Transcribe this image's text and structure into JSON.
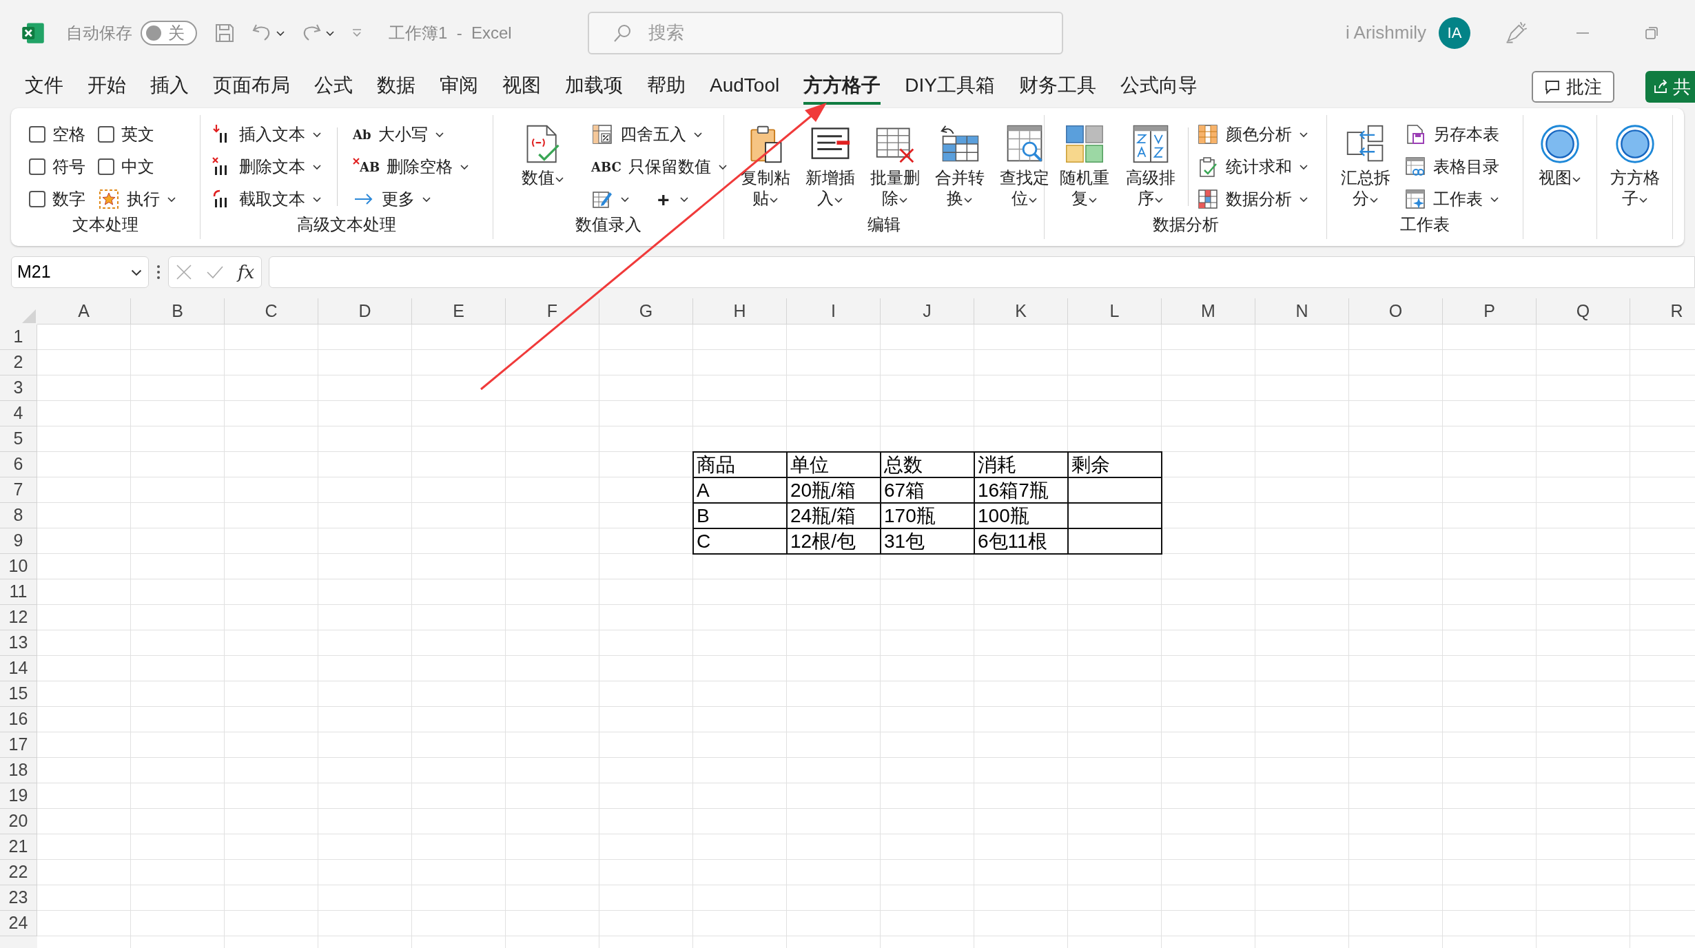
{
  "title_bar": {
    "autosave_label": "自动保存",
    "autosave": {
      "on": false,
      "label": "关"
    },
    "doc_title": "工作簿1  -  Excel",
    "search_placeholder": "搜索",
    "user_name": "i Arishmily",
    "avatar_initials": "IA"
  },
  "menu_tabs": [
    {
      "label": "文件",
      "selected": false
    },
    {
      "label": "开始",
      "selected": false
    },
    {
      "label": "插入",
      "selected": false
    },
    {
      "label": "页面布局",
      "selected": false
    },
    {
      "label": "公式",
      "selected": false
    },
    {
      "label": "数据",
      "selected": false
    },
    {
      "label": "审阅",
      "selected": false
    },
    {
      "label": "视图",
      "selected": false
    },
    {
      "label": "加载项",
      "selected": false
    },
    {
      "label": "帮助",
      "selected": false
    },
    {
      "label": "AudTool",
      "selected": false
    },
    {
      "label": "方方格子",
      "selected": true
    },
    {
      "label": "DIY工具箱",
      "selected": false
    },
    {
      "label": "财务工具",
      "selected": false
    },
    {
      "label": "公式向导",
      "selected": false
    }
  ],
  "comment_button": "批注",
  "share_button": "共",
  "ribbon": [
    {
      "title": "文本处理",
      "columns": [
        [
          {
            "kind": "checkbox",
            "label": "空格",
            "checked": false
          },
          {
            "kind": "checkbox",
            "label": "符号",
            "checked": false
          },
          {
            "kind": "checkbox",
            "label": "数字",
            "checked": false
          }
        ],
        [
          {
            "kind": "checkbox",
            "label": "英文",
            "checked": false
          },
          {
            "kind": "checkbox",
            "label": "中文",
            "checked": false
          },
          {
            "kind": "small",
            "label": "执行",
            "dropdown": true
          }
        ]
      ]
    },
    {
      "title": "高级文本处理",
      "columns": [
        [
          {
            "kind": "small",
            "label": "插入文本",
            "dropdown": true
          },
          {
            "kind": "small",
            "label": "删除文本",
            "dropdown": true
          },
          {
            "kind": "small",
            "label": "截取文本",
            "dropdown": true
          }
        ],
        [
          {
            "kind": "small",
            "label": "大小写",
            "icon_text": "Ab",
            "dropdown": true
          },
          {
            "kind": "small",
            "label": "删除空格",
            "icon_text": "AB",
            "dropdown": true
          },
          {
            "kind": "small",
            "label": "更多",
            "dropdown": true
          }
        ]
      ]
    },
    {
      "title": "数值录入",
      "columns": [
        [
          {
            "kind": "large",
            "label": "数值",
            "dropdown": true
          }
        ],
        [
          {
            "kind": "small",
            "label": "四舍五入",
            "dropdown": true
          },
          {
            "kind": "small",
            "label": "只保留数值",
            "icon_text": "ABC",
            "dropdown": true
          },
          {
            "kind": "pair",
            "second_label": "+",
            "dropdown": true
          }
        ]
      ]
    },
    {
      "title": "编辑",
      "columns": [
        [
          {
            "kind": "large",
            "label": "复制粘贴",
            "dropdown": true
          }
        ],
        [
          {
            "kind": "large",
            "label": "新增插入",
            "dropdown": true
          }
        ],
        [
          {
            "kind": "large",
            "label": "批量删除",
            "dropdown": true
          }
        ],
        [
          {
            "kind": "large",
            "label": "合并转换",
            "dropdown": true
          }
        ],
        [
          {
            "kind": "large",
            "label": "查找定位",
            "dropdown": true
          }
        ]
      ]
    },
    {
      "title": "数据分析",
      "columns": [
        [
          {
            "kind": "large",
            "label": "随机重复",
            "dropdown": true
          }
        ],
        [
          {
            "kind": "large",
            "label": "高级排序",
            "dropdown": true
          }
        ],
        [
          {
            "kind": "small",
            "label": "颜色分析",
            "dropdown": true
          },
          {
            "kind": "small",
            "label": "统计求和",
            "dropdown": true
          },
          {
            "kind": "small",
            "label": "数据分析",
            "dropdown": true
          }
        ]
      ]
    },
    {
      "title": "工作表",
      "columns": [
        [
          {
            "kind": "large",
            "label": "汇总拆分",
            "dropdown": true
          }
        ],
        [
          {
            "kind": "small",
            "label": "另存本表",
            "dropdown": false
          },
          {
            "kind": "small",
            "label": "表格目录",
            "dropdown": false
          },
          {
            "kind": "small",
            "label": "工作表",
            "dropdown": true
          }
        ]
      ]
    },
    {
      "columns": [
        [
          {
            "kind": "large",
            "label": "视图",
            "dropdown": true
          }
        ]
      ]
    },
    {
      "columns": [
        [
          {
            "kind": "large",
            "label": "方方格子",
            "dropdown": true
          }
        ]
      ]
    }
  ],
  "formula_bar": {
    "name_box": "M21",
    "fx_label": "fx"
  },
  "sheet": {
    "columns": [
      "A",
      "B",
      "C",
      "D",
      "E",
      "F",
      "G",
      "H",
      "I",
      "J",
      "K",
      "L",
      "M",
      "N",
      "O",
      "P",
      "Q",
      "R"
    ],
    "row_numbers": [
      "1",
      "2",
      "3",
      "4",
      "5",
      "6",
      "7",
      "8",
      "9",
      "10",
      "11",
      "12",
      "13",
      "14",
      "15",
      "16",
      "17",
      "18",
      "19",
      "20",
      "21",
      "22",
      "23",
      "24"
    ],
    "table": {
      "header": [
        "商品",
        "单位",
        "总数",
        "消耗",
        "剩余"
      ],
      "rows": [
        [
          "A",
          "20瓶/箱",
          "67箱",
          "16箱7瓶"
        ],
        [
          "B",
          "24瓶/箱",
          "170瓶",
          "100瓶"
        ],
        [
          "C",
          "12根/包",
          "31包",
          "6包11根"
        ]
      ]
    }
  }
}
